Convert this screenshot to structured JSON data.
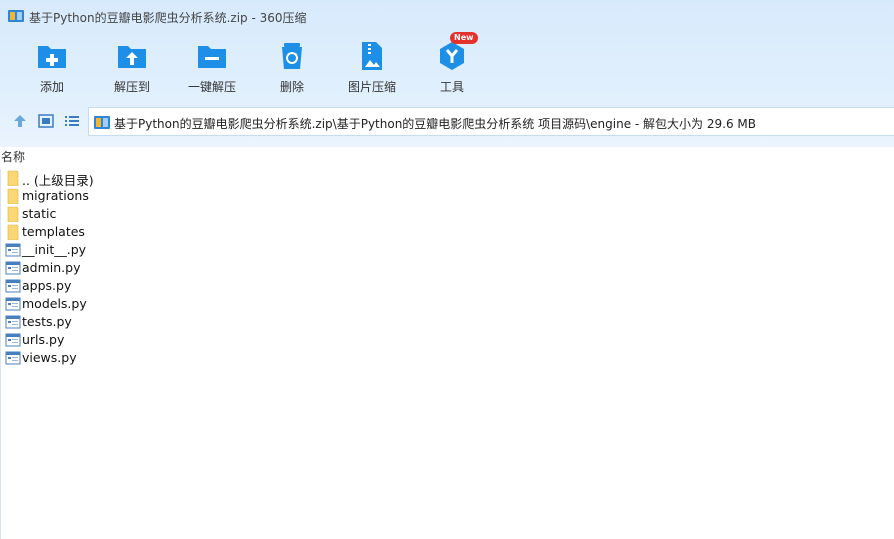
{
  "window": {
    "title": "基于Python的豆瓣电影爬虫分析系统.zip - 360压缩"
  },
  "toolbar": {
    "items": [
      {
        "label": "添加",
        "icon": "add-folder-icon"
      },
      {
        "label": "解压到",
        "icon": "extract-to-icon"
      },
      {
        "label": "一键解压",
        "icon": "one-click-extract-icon"
      },
      {
        "label": "删除",
        "icon": "recycle-bin-icon"
      },
      {
        "label": "图片压缩",
        "icon": "image-compress-icon"
      },
      {
        "label": "工具",
        "icon": "tools-icon",
        "badge": "New"
      }
    ]
  },
  "address": {
    "path": "基于Python的豆瓣电影爬虫分析系统.zip\\基于Python的豆瓣电影爬虫分析系统 项目源码\\engine - 解包大小为 29.6 MB"
  },
  "columns": {
    "name": "名称"
  },
  "files": [
    {
      "name": ".. (上级目录)",
      "type": "folder"
    },
    {
      "name": "migrations",
      "type": "folder"
    },
    {
      "name": "static",
      "type": "folder"
    },
    {
      "name": "templates",
      "type": "folder"
    },
    {
      "name": "__init__.py",
      "type": "file"
    },
    {
      "name": "admin.py",
      "type": "file"
    },
    {
      "name": "apps.py",
      "type": "file"
    },
    {
      "name": "models.py",
      "type": "file"
    },
    {
      "name": "tests.py",
      "type": "file"
    },
    {
      "name": "urls.py",
      "type": "file"
    },
    {
      "name": "views.py",
      "type": "file"
    }
  ],
  "colors": {
    "accent": "#1e8fe6",
    "folder": "#f8d774",
    "badge": "#e5322d"
  }
}
